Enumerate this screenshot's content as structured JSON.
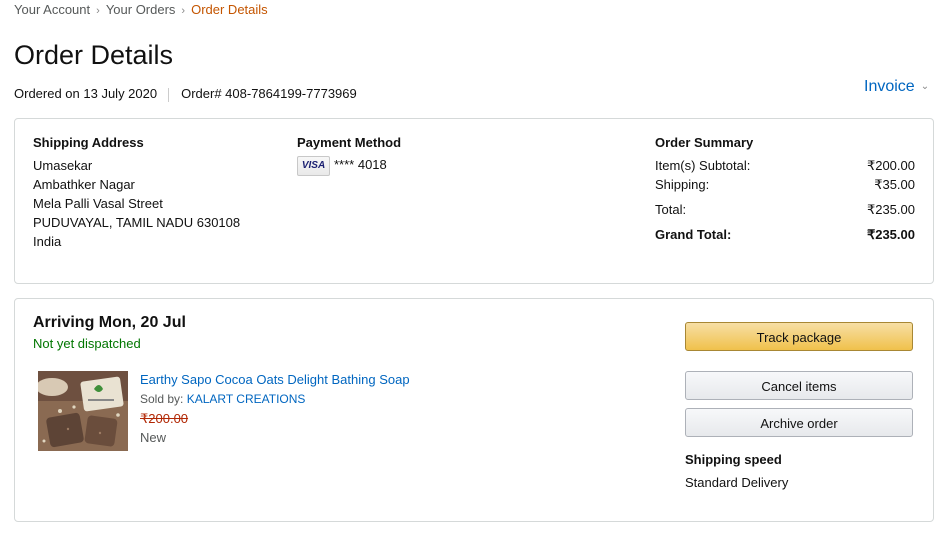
{
  "breadcrumb": {
    "items": [
      "Your Account",
      "Your Orders",
      "Order Details"
    ],
    "separator": "›"
  },
  "page": {
    "title": "Order Details",
    "ordered_on": "Ordered on 13 July 2020",
    "order_number": "Order# 408-7864199-7773969",
    "invoice_label": "Invoice"
  },
  "shipping": {
    "heading": "Shipping Address",
    "lines": [
      "Umasekar",
      "Ambathker Nagar",
      "Mela Palli Vasal Street",
      "PUDUVAYAL, TAMIL NADU 630108",
      "India"
    ]
  },
  "payment": {
    "heading": "Payment Method",
    "card_brand": "VISA",
    "card_digits": "**** 4018"
  },
  "summary": {
    "heading": "Order Summary",
    "rows": [
      {
        "label": "Item(s) Subtotal:",
        "value": "₹200.00"
      },
      {
        "label": "Shipping:",
        "value": "₹35.00"
      },
      {
        "label": "Total:",
        "value": "₹235.00"
      },
      {
        "label": "Grand Total:",
        "value": "₹235.00"
      }
    ]
  },
  "shipment": {
    "arriving": "Arriving Mon, 20 Jul",
    "status": "Not yet dispatched",
    "status_color": "#007600",
    "product_name": "Earthy Sapo Cocoa Oats Delight Bathing Soap",
    "sold_by_label": "Sold by:",
    "seller": "KALART CREATIONS",
    "price": "₹200.00",
    "condition": "New",
    "buttons": {
      "track": "Track package",
      "cancel": "Cancel items",
      "archive": "Archive order"
    },
    "speed_heading": "Shipping speed",
    "speed_value": "Standard Delivery"
  },
  "colors": {
    "link": "#0066c0",
    "breadcrumb_active": "#c45500",
    "price": "#b12704",
    "primary_button": "#f0c14b"
  }
}
